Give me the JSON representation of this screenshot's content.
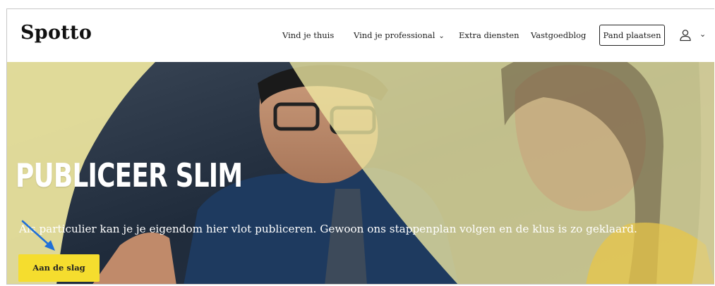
{
  "header": {
    "logo": "Spotto",
    "nav": {
      "vind_je_thuis": "Vind je thuis",
      "vind_je_professional": "Vind je professional",
      "extra_diensten": "Extra diensten",
      "vastgoedblog": "Vastgoedblog"
    },
    "cta_button": "Pand plaatsen"
  },
  "hero": {
    "title": "PUBLICEER SLIM",
    "subtitle": "Als particulier kan je je eigendom hier vlot publiceren. Gewoon ons stappenplan volgen en de klus is zo geklaard.",
    "button": "Aan de slag"
  },
  "icons": {
    "nav_dropdown": "chevron-down-icon",
    "account": "user-icon",
    "account_dropdown": "chevron-down-icon",
    "annotation": "arrow-icon"
  },
  "colors": {
    "brand_yellow": "#f5dd2e",
    "overlay_yellow": "#efe7a0",
    "annotation_blue": "#1f6fd8",
    "text_dark": "#1c1c1c"
  }
}
